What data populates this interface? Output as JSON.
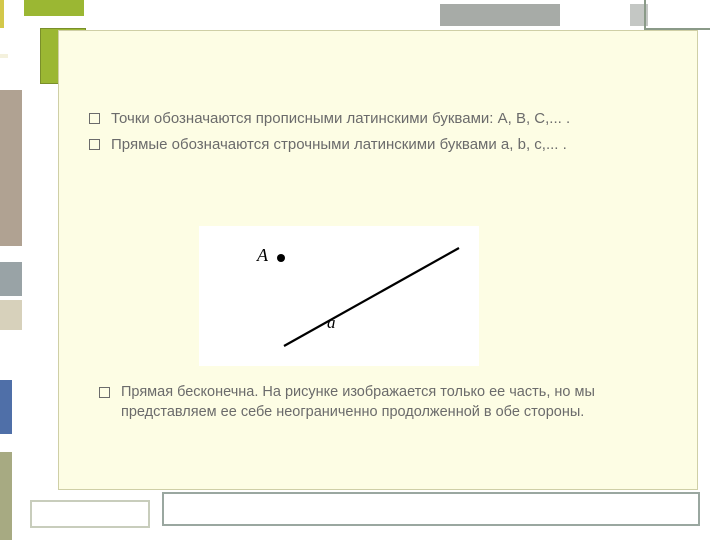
{
  "bullets": {
    "item1": "Точки обозначаются прописными латинскими буквами: А, В, С,... .",
    "item2": " Прямые обозначаются строчными латинскими буквами a, b, c,... ."
  },
  "figure": {
    "point_label": "A",
    "line_label": "a"
  },
  "note": {
    "text": "Прямая бесконечна. На рисунке изображается только ее часть, но мы представляем ее себе неограниченно продолженной в обе стороны."
  }
}
